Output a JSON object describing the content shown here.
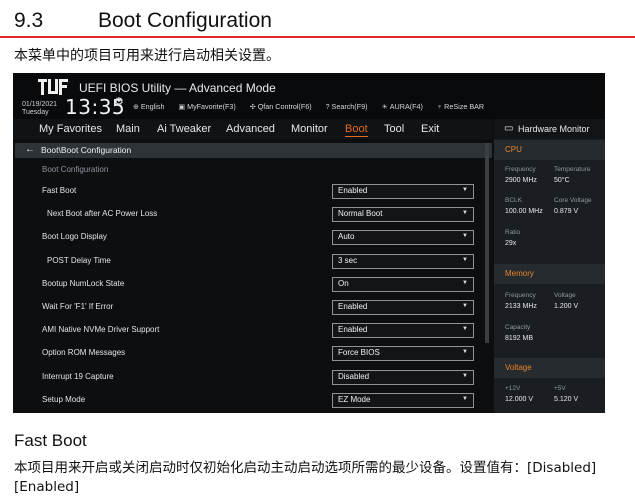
{
  "section": {
    "number": "9.3",
    "title": "Boot Configuration",
    "intro": "本菜单中的项目可用来进行启动相关设置。"
  },
  "bios": {
    "title": "UEFI BIOS Utility — Advanced Mode",
    "date": "01/19/2021",
    "day": "Tuesday",
    "time": "13:35",
    "toolbar": [
      "English",
      "MyFavorite(F3)",
      "Qfan Control(F6)",
      "Search(F9)",
      "AURA(F4)",
      "ReSize BAR"
    ],
    "menu": [
      "My Favorites",
      "Main",
      "Ai Tweaker",
      "Advanced",
      "Monitor",
      "Boot",
      "Tool",
      "Exit"
    ],
    "active_menu": "Boot",
    "breadcrumb": "Boot\\Boot Configuration",
    "group_label": "Boot Configuration",
    "settings": [
      {
        "label": "Fast Boot",
        "value": "Enabled",
        "indent": false
      },
      {
        "label": "Next Boot after AC Power Loss",
        "value": "Normal Boot",
        "indent": true
      },
      {
        "label": "Boot Logo Display",
        "value": "Auto",
        "indent": false
      },
      {
        "label": "POST Delay Time",
        "value": "3 sec",
        "indent": true
      },
      {
        "label": "Bootup NumLock State",
        "value": "On",
        "indent": false
      },
      {
        "label": "Wait For 'F1' If Error",
        "value": "Enabled",
        "indent": false
      },
      {
        "label": "AMI Native NVMe Driver Support",
        "value": "Enabled",
        "indent": false
      },
      {
        "label": "Option ROM Messages",
        "value": "Force BIOS",
        "indent": false
      },
      {
        "label": "Interrupt 19 Capture",
        "value": "Disabled",
        "indent": false
      },
      {
        "label": "Setup Mode",
        "value": "EZ Mode",
        "indent": false
      }
    ],
    "hw_monitor": {
      "title": "Hardware Monitor",
      "cpu": {
        "label": "CPU",
        "frequency_label": "Frequency",
        "frequency": "2900 MHz",
        "temperature_label": "Temperature",
        "temperature": "50°C",
        "bclk_label": "BCLK",
        "bclk": "100.00 MHz",
        "core_voltage_label": "Core Voltage",
        "core_voltage": "0.879 V",
        "ratio_label": "Ratio",
        "ratio": "29x"
      },
      "memory": {
        "label": "Memory",
        "frequency_label": "Frequency",
        "frequency": "2133 MHz",
        "voltage_label": "Voltage",
        "voltage": "1.200 V",
        "capacity_label": "Capacity",
        "capacity": "8192 MB"
      },
      "voltage": {
        "label": "Voltage",
        "v12_label": "+12V",
        "v12": "12.000 V",
        "v5_label": "+5V",
        "v5": "5.120 V"
      }
    }
  },
  "fast_boot": {
    "title": "Fast Boot",
    "description": "本项目用来开启或关闭启动时仅初始化启动主动启动选项所需的最少设备。设置值有：[Disabled] [Enabled]"
  },
  "colors": {
    "accent_red": "#e3262a",
    "bios_bg": "#0c0e10",
    "active_orange": "#e36a1e",
    "category_orange": "#e8842a"
  }
}
